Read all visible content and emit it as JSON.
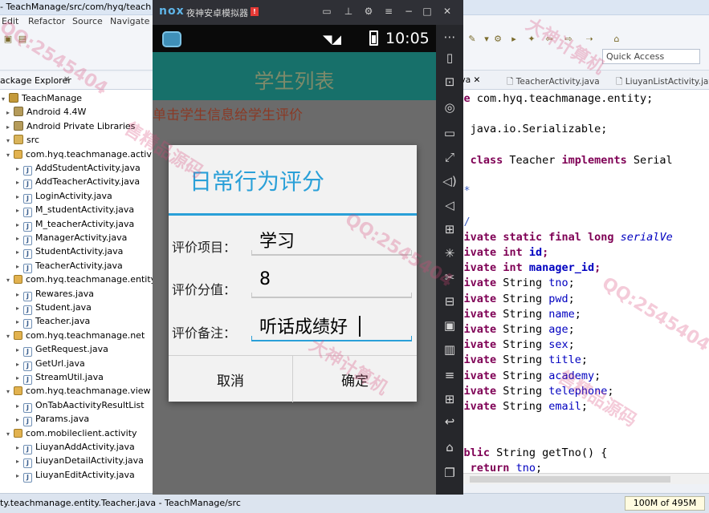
{
  "eclipse": {
    "title": "- TeachManage/src/com/hyq/teach",
    "menu": [
      "Edit",
      "Refactor",
      "Source",
      "Navigate"
    ],
    "quick_access": "Quick Access",
    "package_explorer": {
      "tab_label": "ackage Explorer",
      "tree": [
        {
          "label": "TeachManage",
          "icon": "project-icon",
          "level": 0,
          "twist": "▾"
        },
        {
          "label": "Android 4.4W",
          "icon": "library-icon",
          "level": 1,
          "twist": "▸"
        },
        {
          "label": "Android Private Libraries",
          "icon": "library-icon",
          "level": 1,
          "twist": "▸"
        },
        {
          "label": "src",
          "icon": "source-folder-icon",
          "level": 1,
          "twist": "▾"
        },
        {
          "label": "com.hyq.teachmanage.activ",
          "icon": "package-icon",
          "level": 2,
          "twist": "▾"
        },
        {
          "label": "AddStudentActivity.java",
          "icon": "java-file-icon",
          "level": 3,
          "twist": "▸"
        },
        {
          "label": "AddTeacherActivity.java",
          "icon": "java-file-icon",
          "level": 3,
          "twist": "▸"
        },
        {
          "label": "LoginActivity.java",
          "icon": "java-file-icon",
          "level": 3,
          "twist": "▸"
        },
        {
          "label": "M_studentActivity.java",
          "icon": "java-file-icon",
          "level": 3,
          "twist": "▸"
        },
        {
          "label": "M_teacherActivity.java",
          "icon": "java-file-icon",
          "level": 3,
          "twist": "▸"
        },
        {
          "label": "ManagerActivity.java",
          "icon": "java-file-icon",
          "level": 3,
          "twist": "▸"
        },
        {
          "label": "StudentActivity.java",
          "icon": "java-file-icon",
          "level": 3,
          "twist": "▸"
        },
        {
          "label": "TeacherActivity.java",
          "icon": "java-file-icon",
          "level": 3,
          "twist": "▸"
        },
        {
          "label": "com.hyq.teachmanage.entity",
          "icon": "package-icon",
          "level": 2,
          "twist": "▾"
        },
        {
          "label": "Rewares.java",
          "icon": "java-file-icon",
          "level": 3,
          "twist": "▸"
        },
        {
          "label": "Student.java",
          "icon": "java-file-icon",
          "level": 3,
          "twist": "▸"
        },
        {
          "label": "Teacher.java",
          "icon": "java-file-icon",
          "level": 3,
          "twist": "▸"
        },
        {
          "label": "com.hyq.teachmanage.net",
          "icon": "package-icon",
          "level": 2,
          "twist": "▾"
        },
        {
          "label": "GetRequest.java",
          "icon": "java-file-icon",
          "level": 3,
          "twist": "▸"
        },
        {
          "label": "GetUrl.java",
          "icon": "java-file-icon",
          "level": 3,
          "twist": "▸"
        },
        {
          "label": "StreamUtil.java",
          "icon": "java-file-icon",
          "level": 3,
          "twist": "▸"
        },
        {
          "label": "com.hyq.teachmanage.view",
          "icon": "package-icon",
          "level": 2,
          "twist": "▾"
        },
        {
          "label": "OnTabAactivityResultList",
          "icon": "java-file-icon",
          "level": 3,
          "twist": "▸"
        },
        {
          "label": "Params.java",
          "icon": "java-file-icon",
          "level": 3,
          "twist": "▸"
        },
        {
          "label": "com.mobileclient.activity",
          "icon": "package-icon",
          "level": 2,
          "twist": "▾"
        },
        {
          "label": "LiuyanAddActivity.java",
          "icon": "java-file-icon",
          "level": 3,
          "twist": "▸"
        },
        {
          "label": "LiuyanDetailActivity.java",
          "icon": "java-file-icon",
          "level": 3,
          "twist": "▸"
        },
        {
          "label": "LiuyanEditActivity.java",
          "icon": "java-file-icon",
          "level": 3,
          "twist": "▸"
        }
      ]
    },
    "editor": {
      "tabs": [
        "er.java",
        "TeacherActivity.java",
        "LiuyanListActivity.java"
      ],
      "code": [
        "ckage com.hyq.teachmanage.entity;",
        "",
        "port java.io.Serializable;",
        "",
        "blic class Teacher implements Serial",
        "",
        "  /**",
        "   *",
        "   */",
        "  private static final long serialVe",
        "  private int id;",
        "  private int manager_id;",
        "  private String tno;",
        "  private String pwd;",
        "  private String name;",
        "  private String age;",
        "  private String sex;",
        "  private String title;",
        "  private String academy;",
        "  private String telephone;",
        "  private String email;",
        "",
        "",
        "  public String getTno() {",
        "     return tno;"
      ]
    },
    "statusbar": {
      "path": "ty.teachmanage.entity.Teacher.java - TeachManage/src",
      "memory": "100M of 495M"
    }
  },
  "nox": {
    "logo": "nox",
    "title": "夜神安卓模拟器",
    "status_time": "10:05",
    "app": {
      "action_bar_title": "学生列表",
      "hint": "单击学生信息给学生评价"
    },
    "dialog": {
      "title": "日常行为评分",
      "fields": [
        {
          "label": "评价项目：",
          "value": "学习"
        },
        {
          "label": "评价分值：",
          "value": "8"
        },
        {
          "label": "评价备注：",
          "value": "听话成绩好"
        }
      ],
      "cancel": "取消",
      "confirm": "确定"
    }
  },
  "watermark": {
    "text1": "QQ:2545404",
    "text2": "大神计算机",
    "text3": "售精品源码"
  },
  "colors": {
    "accent": "#2aa0d8",
    "action_bar": "#17706a",
    "hint_text": "#8a3a26"
  }
}
